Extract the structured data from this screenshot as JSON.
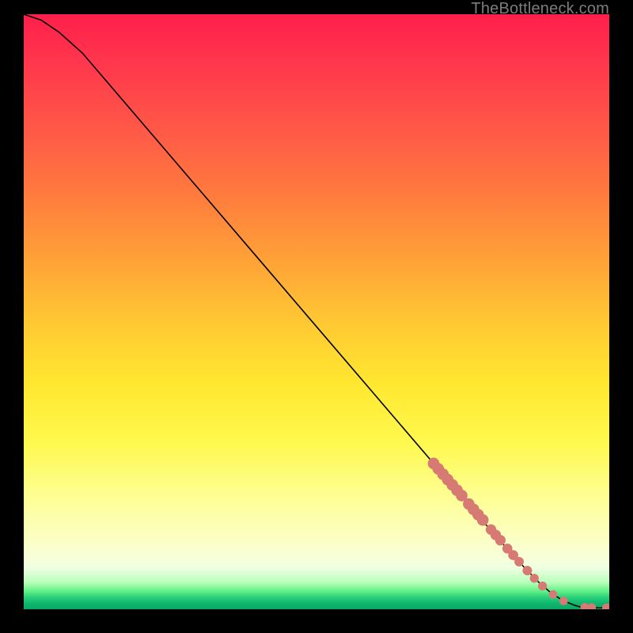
{
  "attribution": "TheBottleneck.com",
  "chart_data": {
    "type": "line",
    "title": "",
    "xlabel": "",
    "ylabel": "",
    "xlim": [
      0,
      100
    ],
    "ylim": [
      0,
      100
    ],
    "series": [
      {
        "name": "curve",
        "x": [
          0,
          3,
          6,
          10,
          20,
          30,
          40,
          50,
          60,
          70,
          75,
          78,
          80,
          82,
          84,
          86,
          88,
          90,
          92,
          94,
          95,
          97,
          100
        ],
        "y": [
          100,
          99,
          97,
          93.5,
          82,
          70.5,
          59,
          47.5,
          36,
          24.5,
          18.7,
          15.3,
          13,
          10.8,
          8.6,
          6.5,
          4.5,
          2.8,
          1.5,
          0.7,
          0.4,
          0.25,
          0.25
        ]
      }
    ],
    "markers": [
      {
        "x": 70.0,
        "y": 24.5,
        "r": 1.1
      },
      {
        "x": 70.8,
        "y": 23.6,
        "r": 1.1
      },
      {
        "x": 71.6,
        "y": 22.7,
        "r": 1.1
      },
      {
        "x": 72.4,
        "y": 21.8,
        "r": 1.1
      },
      {
        "x": 73.2,
        "y": 20.9,
        "r": 1.1
      },
      {
        "x": 74.0,
        "y": 20.0,
        "r": 1.1
      },
      {
        "x": 74.8,
        "y": 19.1,
        "r": 1.1
      },
      {
        "x": 76.0,
        "y": 17.7,
        "r": 1.1
      },
      {
        "x": 76.8,
        "y": 16.8,
        "r": 1.1
      },
      {
        "x": 77.6,
        "y": 15.9,
        "r": 1.1
      },
      {
        "x": 78.4,
        "y": 15.0,
        "r": 1.1
      },
      {
        "x": 79.8,
        "y": 13.4,
        "r": 1.0
      },
      {
        "x": 80.6,
        "y": 12.5,
        "r": 1.0
      },
      {
        "x": 81.4,
        "y": 11.6,
        "r": 1.0
      },
      {
        "x": 82.6,
        "y": 10.2,
        "r": 0.95
      },
      {
        "x": 83.6,
        "y": 9.1,
        "r": 0.95
      },
      {
        "x": 84.6,
        "y": 8.0,
        "r": 0.9
      },
      {
        "x": 86.0,
        "y": 6.5,
        "r": 0.9
      },
      {
        "x": 87.2,
        "y": 5.2,
        "r": 0.85
      },
      {
        "x": 88.6,
        "y": 3.9,
        "r": 0.85
      },
      {
        "x": 90.4,
        "y": 2.5,
        "r": 0.8
      },
      {
        "x": 92.2,
        "y": 1.4,
        "r": 0.8
      },
      {
        "x": 95.8,
        "y": 0.35,
        "r": 0.8
      },
      {
        "x": 97.0,
        "y": 0.3,
        "r": 0.8
      },
      {
        "x": 99.5,
        "y": 0.25,
        "r": 0.8
      },
      {
        "x": 100.0,
        "y": 0.25,
        "r": 0.8
      }
    ],
    "gradient_note": "background is a vertical heat gradient red→yellow→green representing bottleneck severity"
  }
}
